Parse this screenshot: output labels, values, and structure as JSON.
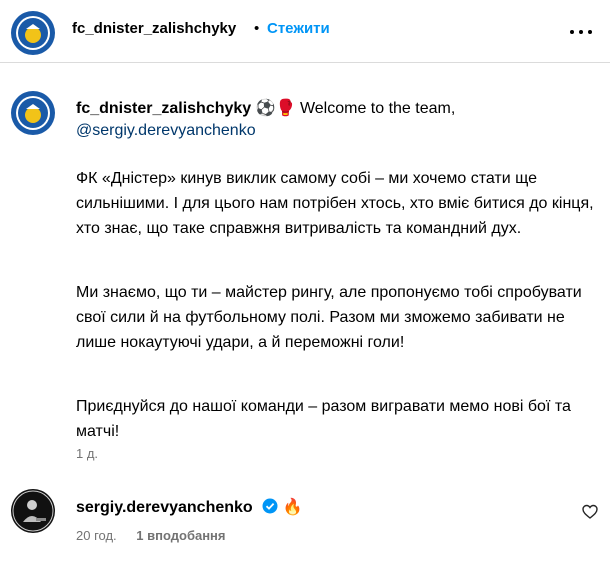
{
  "header": {
    "username": "fc_dnister_zalishchyky",
    "separator": "•",
    "follow_label": "Стежити",
    "more_icon": "more-horizontal-icon"
  },
  "caption": {
    "username": "fc_dnister_zalishchyky",
    "emojis": "⚽🥊",
    "text_start": "Welcome to the team,",
    "mention": "@sergiy.derevyanchenko",
    "paragraphs": [
      "ФК «Дністер» кинув виклик самому собі – ми хочемо стати ще сильнішими. І для цього нам потрібен хтось, хто вміє битися до кінця, хто знає, що таке справжня витривалість та командний дух.",
      "Ми знаємо, що ти – майстер рингу, але пропонуємо тобі спробувати свої сили й на футбольному полі. Разом ми зможемо забивати не лише нокаутуючі удари, а й переможні голи!",
      "Приєднуйся до нашої команди – разом вигравати мемо нові бої та матчі!"
    ],
    "time": "1 д."
  },
  "comment": {
    "username": "sergiy.derevyanchenko",
    "verified_icon": "verified-badge-icon",
    "text": "🔥",
    "time": "20 год.",
    "likes": "1 вподобання",
    "like_icon": "heart-outline-icon"
  },
  "colors": {
    "link_blue": "#0095f6",
    "mention_blue": "#00376b",
    "secondary_text": "#737373",
    "divider": "#dbdbdb",
    "logo_blue": "#1a5aa8",
    "logo_yellow": "#f2c318"
  }
}
